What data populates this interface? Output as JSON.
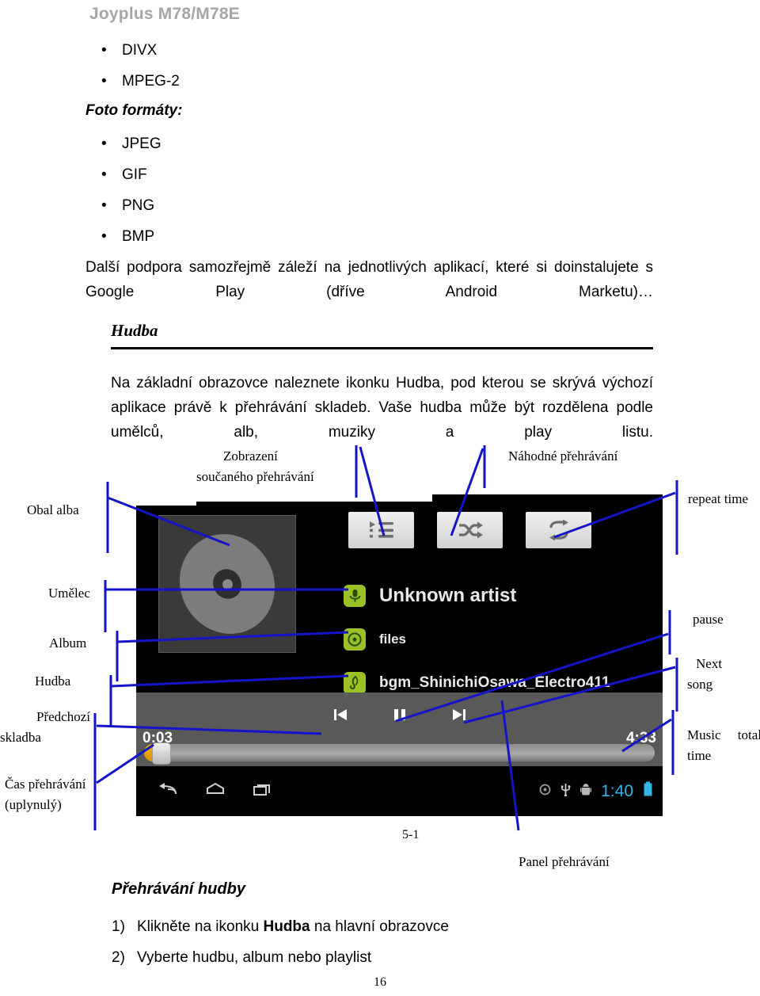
{
  "header": {
    "title": "Joyplus M78/M78E"
  },
  "format_list": {
    "items_top": [
      "DIVX",
      "MPEG-2"
    ],
    "photo_heading": "Foto formáty:",
    "items_photo": [
      "JPEG",
      "GIF",
      "PNG",
      "BMP"
    ]
  },
  "paragraphs": {
    "support": "Další podpora samozřejmě záleží na jednotlivých aplikací, které si doinstalujete s Google Play (dříve Android Marketu)…",
    "music_intro": "Na základní obrazovce naleznete ikonku Hudba, pod kterou se skrývá výchozí aplikace právě k přehrávání skladeb. Vaše hudba může být rozdělena podle umělců, alb, muziky a play listu."
  },
  "section": {
    "heading": "Hudba"
  },
  "figure": {
    "number": "5-1",
    "callouts": {
      "album_art": "Obal alba",
      "now_playing_line1": "Zobrazení",
      "now_playing_line2": "součaného přehrávání",
      "shuffle": "Náhodné přehrávání",
      "repeat": "repeat time",
      "artist": "Umělec",
      "album": "Album",
      "music": "Hudba",
      "prev_line1": "Předchozí",
      "prev_line2": "skladba",
      "elapsed_line1": "Čas přehrávání",
      "elapsed_line2": "(uplynulý)",
      "pause": "pause",
      "next_line1": "Next",
      "next_line2": "song",
      "total_line1": "Music     total",
      "total_line2": "time",
      "panel": "Panel přehrávání"
    },
    "player": {
      "buttons": {
        "playlist_icon": "playlist-icon",
        "shuffle_icon": "shuffle-icon",
        "repeat_icon": "repeat-icon"
      },
      "metadata": [
        {
          "icon": "microphone-icon",
          "text": "Unknown artist"
        },
        {
          "icon": "disc-icon",
          "text": "files"
        },
        {
          "icon": "music-note-icon",
          "text": "bgm_ShinichiOsawa_Electro411"
        }
      ],
      "transport": {
        "previous_icon": "skip-previous-icon",
        "pause_icon": "pause-icon",
        "next_icon": "skip-next-icon"
      },
      "elapsed_time": "0:03",
      "total_time": "4:33",
      "progress_percent": 1.1,
      "navbar": {
        "back_icon": "back-icon",
        "home_icon": "home-icon",
        "recents_icon": "recents-icon",
        "status_disc_icon": "disc-status-icon",
        "status_usb_icon": "usb-icon",
        "status_adb_icon": "android-debug-icon",
        "clock": "1:40",
        "battery_icon": "battery-icon"
      }
    }
  },
  "caption": {
    "heading": "Přehrávání hudby"
  },
  "steps": [
    {
      "n": "1)",
      "pre": "Klikněte na ikonku ",
      "bold": "Hudba",
      "post": " na hlavní obrazovce"
    },
    {
      "n": "2)",
      "pre": "Vyberte hudbu, album nebo playlist",
      "bold": "",
      "post": ""
    }
  ],
  "page_number": "16",
  "colors": {
    "header_gray": "#a6a6a6",
    "callout_blue": "#1414c8",
    "accent_green": "#9ac227",
    "status_blue": "#33b5e5",
    "progress_orange": "#f2b200"
  }
}
